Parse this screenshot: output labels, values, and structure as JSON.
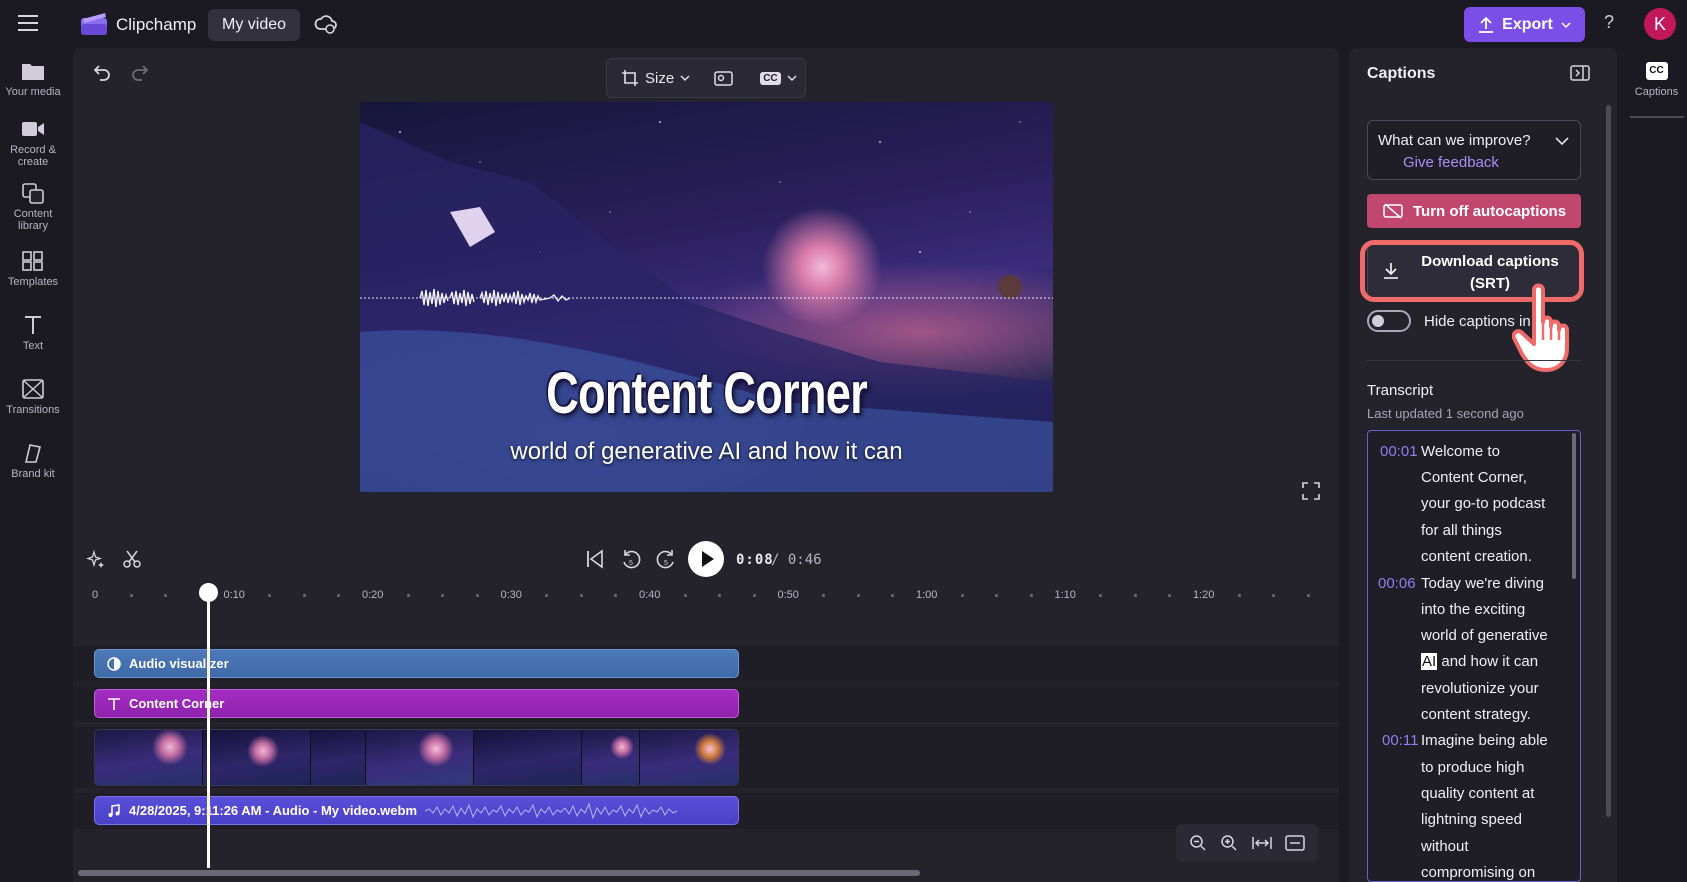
{
  "app": {
    "name": "Clipchamp",
    "project_tab": "My video"
  },
  "header": {
    "export_label": "Export",
    "help": "?",
    "avatar_initial": "K",
    "accent": "#7b4ee8"
  },
  "sidebar": {
    "items": [
      {
        "label": "Your media",
        "icon": "folder-icon"
      },
      {
        "label": "Record &",
        "label2": "create",
        "icon": "camera-icon"
      },
      {
        "label": "Content",
        "label2": "library",
        "icon": "library-icon"
      },
      {
        "label": "Templates",
        "icon": "templates-icon"
      },
      {
        "label": "Text",
        "icon": "text-icon"
      },
      {
        "label": "Transitions",
        "icon": "transitions-icon"
      },
      {
        "label": "Brand kit",
        "icon": "brand-kit-icon"
      }
    ]
  },
  "toolbar": {
    "size_label": "Size",
    "cc_label": "CC"
  },
  "preview": {
    "title": "Content Corner",
    "caption": "world of generative AI and how it can"
  },
  "playback": {
    "current_time": "0:08",
    "separator": "/",
    "duration": "0:46"
  },
  "ruler": {
    "labels": [
      "0",
      "0:10",
      "0:20",
      "0:30",
      "0:40",
      "0:50",
      "1:00",
      "1:10",
      "1:20"
    ]
  },
  "timeline": {
    "audio_track": "Audio visualizer",
    "text_track": "Content Corner",
    "music_track": "4/28/2025, 9:11:26 AM - Audio - My video.webm"
  },
  "captions_panel": {
    "title": "Captions",
    "feedback_question": "What can we improve?",
    "feedback_link": "Give feedback",
    "autocaptions_button": "Turn off autocaptions",
    "download_line1": "Download captions",
    "download_line2": "(SRT)",
    "hide_toggle_label": "Hide captions in",
    "transcript_heading": "Transcript",
    "transcript_updated": "Last updated 1 second ago",
    "transcript": [
      {
        "time": "00:01",
        "lines": [
          "Welcome to",
          "Content Corner,",
          "your go-to podcast",
          "for all things",
          "content creation."
        ]
      },
      {
        "time": "00:06",
        "lines": [
          "Today we're diving",
          "into the exciting",
          "world of generative",
          "and how it can",
          "revolutionize your",
          "content strategy."
        ],
        "highlight": "AI"
      },
      {
        "time": "00:11",
        "lines": [
          "Imagine being able",
          "to produce high",
          "quality content at",
          "lightning speed",
          "without",
          "compromising on"
        ]
      }
    ]
  },
  "right_tab": {
    "badge": "CC",
    "label": "Captions"
  }
}
